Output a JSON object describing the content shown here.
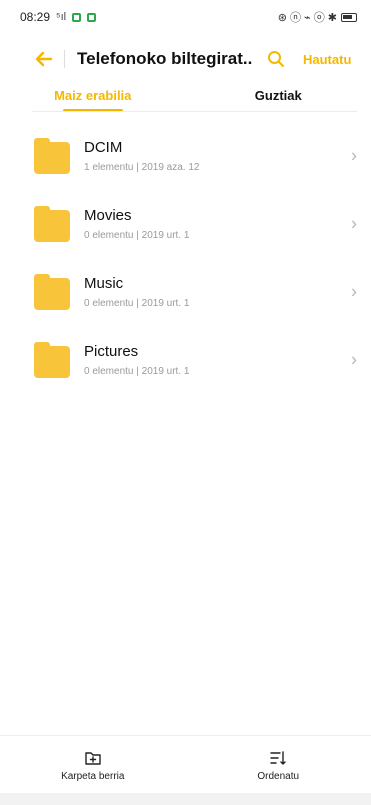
{
  "status_bar": {
    "time": "08:29",
    "signal": "⁵ıl",
    "indicators": "⊛ ⓝ ⌁ ⓞ ✱"
  },
  "header": {
    "title": "Telefonoko biltegirat...",
    "action_label": "Hautatu",
    "accent_color": "#f5b800"
  },
  "tabs": [
    {
      "label": "Maiz erabilia",
      "active": true
    },
    {
      "label": "Guztiak",
      "active": false
    }
  ],
  "folders": [
    {
      "name": "DCIM",
      "meta": "1 elementu | 2019 aza. 12"
    },
    {
      "name": "Movies",
      "meta": "0 elementu | 2019 urt. 1"
    },
    {
      "name": "Music",
      "meta": "0 elementu | 2019 urt. 1"
    },
    {
      "name": "Pictures",
      "meta": "0 elementu | 2019 urt. 1"
    }
  ],
  "bottom_bar": {
    "new_folder_label": "Karpeta berria",
    "sort_label": "Ordenatu"
  }
}
